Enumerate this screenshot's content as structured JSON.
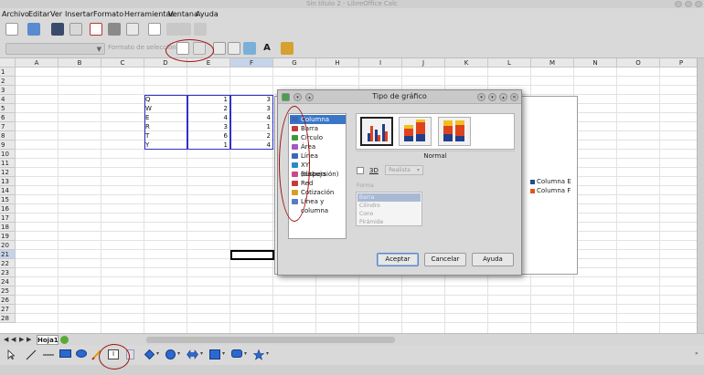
{
  "window": {
    "title": "Sin título 2 - LibreOffice Calc"
  },
  "menu": [
    "Archivo",
    "Editar",
    "Ver",
    "Insertar",
    "Formato",
    "Herramientas",
    "Ventana",
    "Ayuda"
  ],
  "toolbar2": {
    "style_placeholder": "Formato de selección"
  },
  "grid": {
    "columns": [
      "A",
      "B",
      "C",
      "D",
      "E",
      "F",
      "G",
      "H",
      "I",
      "J",
      "K",
      "L",
      "M",
      "N",
      "O",
      "P"
    ],
    "rows": [
      "1",
      "2",
      "3",
      "4",
      "5",
      "6",
      "7",
      "8",
      "9",
      "10",
      "11",
      "12",
      "13",
      "14",
      "15",
      "16",
      "17",
      "18",
      "19",
      "20",
      "21",
      "22",
      "23",
      "24",
      "25",
      "26",
      "27",
      "28"
    ],
    "selected_column": "F",
    "selected_row": "21",
    "data_rows": [
      {
        "label": "Q",
        "e": "1",
        "f": "3"
      },
      {
        "label": "W",
        "e": "2",
        "f": "3"
      },
      {
        "label": "E",
        "e": "4",
        "f": "4"
      },
      {
        "label": "R",
        "e": "3",
        "f": "1"
      },
      {
        "label": "T",
        "e": "6",
        "f": "2"
      },
      {
        "label": "Y",
        "e": "1",
        "f": "4"
      }
    ]
  },
  "chart": {
    "legend": [
      {
        "name": "Columna E",
        "color": "#1f4e8c"
      },
      {
        "name": "Columna F",
        "color": "#e8511e"
      }
    ]
  },
  "dialog": {
    "title": "Tipo de gráfico",
    "types": [
      {
        "label": "Columna",
        "icon": "column-chart-icon",
        "color": "#3a68b8"
      },
      {
        "label": "Barra",
        "icon": "bar-chart-icon",
        "color": "#c83a3a"
      },
      {
        "label": "Círculo",
        "icon": "pie-chart-icon",
        "color": "#3a9a3a"
      },
      {
        "label": "Área",
        "icon": "area-chart-icon",
        "color": "#a05ac0"
      },
      {
        "label": "Línea",
        "icon": "line-chart-icon",
        "color": "#3a68b8"
      },
      {
        "label": "XY (dispersión)",
        "icon": "scatter-chart-icon",
        "color": "#2a8ac8"
      },
      {
        "label": "Burbuja",
        "icon": "bubble-chart-icon",
        "color": "#c84a8a"
      },
      {
        "label": "Red",
        "icon": "net-chart-icon",
        "color": "#c83a3a"
      },
      {
        "label": "Cotización",
        "icon": "stock-chart-icon",
        "color": "#d8a020"
      },
      {
        "label": "Línea y columna",
        "icon": "column-line-chart-icon",
        "color": "#5a7ac8"
      }
    ],
    "selected_type_index": 0,
    "variant_label": "Normal",
    "threed_label": "3D",
    "realista": "Realista",
    "forma_label": "Forma",
    "forma_items": [
      "Barra",
      "Cilindro",
      "Cono",
      "Pirámide"
    ],
    "buttons": {
      "ok": "Aceptar",
      "cancel": "Cancelar",
      "help": "Ayuda"
    }
  },
  "sheet": {
    "tab": "Hoja1"
  }
}
